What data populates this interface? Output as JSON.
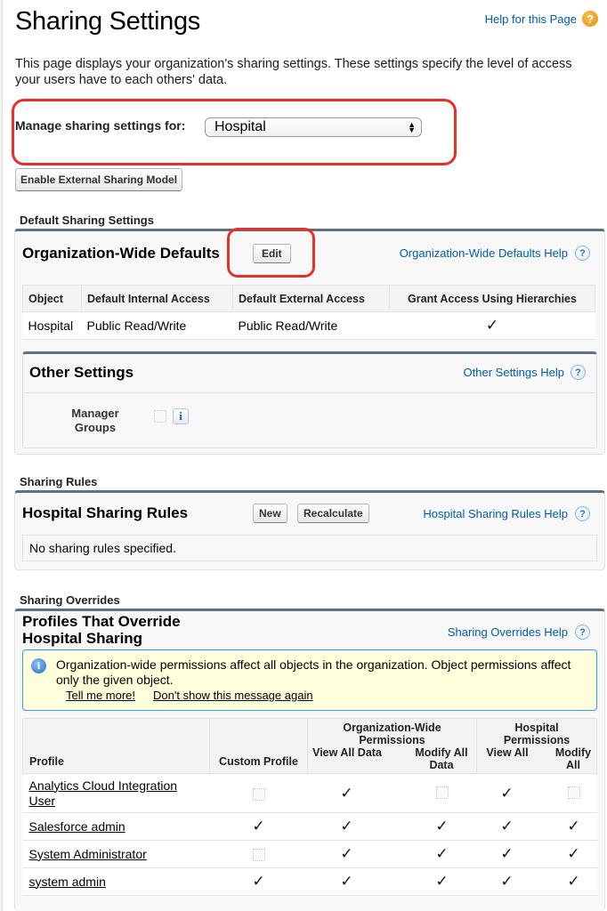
{
  "page": {
    "title": "Sharing Settings",
    "help_link": "Help for this Page",
    "description": "This page displays your organization's sharing settings. These settings specify the level of access your users have to each others' data."
  },
  "manage": {
    "label": "Manage sharing settings for:",
    "selected": "Hospital"
  },
  "buttons": {
    "enable_external": "Enable External Sharing Model",
    "edit": "Edit",
    "new": "New",
    "recalculate": "Recalculate"
  },
  "default_sharing": {
    "section_label": "Default Sharing Settings",
    "panel_title": "Organization-Wide Defaults",
    "help_link": "Organization-Wide Defaults Help",
    "columns": [
      "Object",
      "Default Internal Access",
      "Default External Access",
      "Grant Access Using Hierarchies"
    ],
    "rows": [
      {
        "object": "Hospital",
        "internal": "Public Read/Write",
        "external": "Public Read/Write",
        "grant_hierarchies": true
      }
    ]
  },
  "other_settings": {
    "title": "Other Settings",
    "help_link": "Other Settings Help",
    "manager_groups_label": "Manager Groups",
    "manager_groups_checked": false
  },
  "sharing_rules": {
    "section_label": "Sharing Rules",
    "panel_title": "Hospital Sharing Rules",
    "help_link": "Hospital Sharing Rules Help",
    "empty_text": "No sharing rules specified."
  },
  "sharing_overrides": {
    "section_label": "Sharing Overrides",
    "panel_title_line1": "Profiles That Override",
    "panel_title_line2": "Hospital Sharing",
    "help_link": "Sharing Overrides Help",
    "alert": {
      "text": "Organization-wide permissions affect all objects in the organization. Object permissions affect only the given object.",
      "link_more": "Tell me more!",
      "link_dismiss": "Don't show this message again"
    },
    "headers": {
      "profile": "Profile",
      "custom_profile": "Custom Profile",
      "org_group": "Organization-Wide Permissions",
      "org_view": "View All Data",
      "org_modify": "Modify All Data",
      "obj_group": "Hospital Permissions",
      "obj_view": "View All",
      "obj_modify": "Modify All"
    },
    "rows": [
      {
        "profile": "Analytics Cloud Integration User",
        "custom": false,
        "view_all_data": true,
        "modify_all_data": false,
        "view_all": true,
        "modify_all": false
      },
      {
        "profile": "Salesforce admin",
        "custom": true,
        "view_all_data": true,
        "modify_all_data": true,
        "view_all": true,
        "modify_all": true
      },
      {
        "profile": "System Administrator",
        "custom": false,
        "view_all_data": true,
        "modify_all_data": true,
        "view_all": true,
        "modify_all": true
      },
      {
        "profile": "system admin",
        "custom": true,
        "view_all_data": true,
        "modify_all_data": true,
        "view_all": true,
        "modify_all": true
      }
    ]
  },
  "icons": {
    "check": "✓",
    "question": "?",
    "info": "i"
  },
  "colors": {
    "link": "#015ba7",
    "highlight": "#e8302a",
    "panel_top": "#5f6f85",
    "alert_bg": "#ffffdc"
  }
}
